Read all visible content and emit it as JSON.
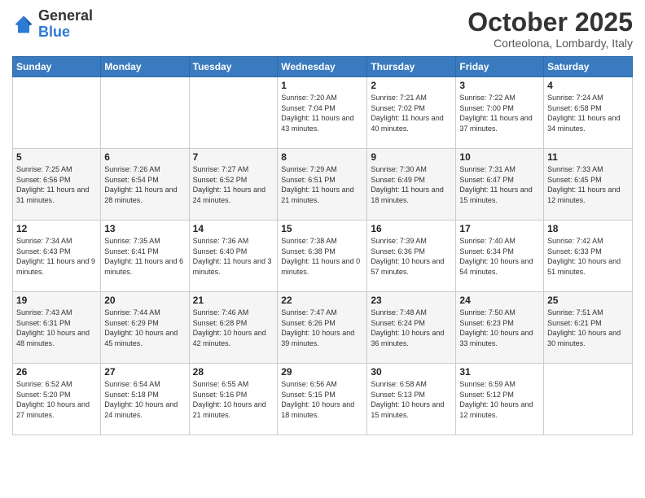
{
  "header": {
    "logo_general": "General",
    "logo_blue": "Blue",
    "month_title": "October 2025",
    "location": "Corteolona, Lombardy, Italy"
  },
  "days_of_week": [
    "Sunday",
    "Monday",
    "Tuesday",
    "Wednesday",
    "Thursday",
    "Friday",
    "Saturday"
  ],
  "weeks": [
    [
      {
        "day": "",
        "info": ""
      },
      {
        "day": "",
        "info": ""
      },
      {
        "day": "",
        "info": ""
      },
      {
        "day": "1",
        "info": "Sunrise: 7:20 AM\nSunset: 7:04 PM\nDaylight: 11 hours\nand 43 minutes."
      },
      {
        "day": "2",
        "info": "Sunrise: 7:21 AM\nSunset: 7:02 PM\nDaylight: 11 hours\nand 40 minutes."
      },
      {
        "day": "3",
        "info": "Sunrise: 7:22 AM\nSunset: 7:00 PM\nDaylight: 11 hours\nand 37 minutes."
      },
      {
        "day": "4",
        "info": "Sunrise: 7:24 AM\nSunset: 6:58 PM\nDaylight: 11 hours\nand 34 minutes."
      }
    ],
    [
      {
        "day": "5",
        "info": "Sunrise: 7:25 AM\nSunset: 6:56 PM\nDaylight: 11 hours\nand 31 minutes."
      },
      {
        "day": "6",
        "info": "Sunrise: 7:26 AM\nSunset: 6:54 PM\nDaylight: 11 hours\nand 28 minutes."
      },
      {
        "day": "7",
        "info": "Sunrise: 7:27 AM\nSunset: 6:52 PM\nDaylight: 11 hours\nand 24 minutes."
      },
      {
        "day": "8",
        "info": "Sunrise: 7:29 AM\nSunset: 6:51 PM\nDaylight: 11 hours\nand 21 minutes."
      },
      {
        "day": "9",
        "info": "Sunrise: 7:30 AM\nSunset: 6:49 PM\nDaylight: 11 hours\nand 18 minutes."
      },
      {
        "day": "10",
        "info": "Sunrise: 7:31 AM\nSunset: 6:47 PM\nDaylight: 11 hours\nand 15 minutes."
      },
      {
        "day": "11",
        "info": "Sunrise: 7:33 AM\nSunset: 6:45 PM\nDaylight: 11 hours\nand 12 minutes."
      }
    ],
    [
      {
        "day": "12",
        "info": "Sunrise: 7:34 AM\nSunset: 6:43 PM\nDaylight: 11 hours\nand 9 minutes."
      },
      {
        "day": "13",
        "info": "Sunrise: 7:35 AM\nSunset: 6:41 PM\nDaylight: 11 hours\nand 6 minutes."
      },
      {
        "day": "14",
        "info": "Sunrise: 7:36 AM\nSunset: 6:40 PM\nDaylight: 11 hours\nand 3 minutes."
      },
      {
        "day": "15",
        "info": "Sunrise: 7:38 AM\nSunset: 6:38 PM\nDaylight: 11 hours\nand 0 minutes."
      },
      {
        "day": "16",
        "info": "Sunrise: 7:39 AM\nSunset: 6:36 PM\nDaylight: 10 hours\nand 57 minutes."
      },
      {
        "day": "17",
        "info": "Sunrise: 7:40 AM\nSunset: 6:34 PM\nDaylight: 10 hours\nand 54 minutes."
      },
      {
        "day": "18",
        "info": "Sunrise: 7:42 AM\nSunset: 6:33 PM\nDaylight: 10 hours\nand 51 minutes."
      }
    ],
    [
      {
        "day": "19",
        "info": "Sunrise: 7:43 AM\nSunset: 6:31 PM\nDaylight: 10 hours\nand 48 minutes."
      },
      {
        "day": "20",
        "info": "Sunrise: 7:44 AM\nSunset: 6:29 PM\nDaylight: 10 hours\nand 45 minutes."
      },
      {
        "day": "21",
        "info": "Sunrise: 7:46 AM\nSunset: 6:28 PM\nDaylight: 10 hours\nand 42 minutes."
      },
      {
        "day": "22",
        "info": "Sunrise: 7:47 AM\nSunset: 6:26 PM\nDaylight: 10 hours\nand 39 minutes."
      },
      {
        "day": "23",
        "info": "Sunrise: 7:48 AM\nSunset: 6:24 PM\nDaylight: 10 hours\nand 36 minutes."
      },
      {
        "day": "24",
        "info": "Sunrise: 7:50 AM\nSunset: 6:23 PM\nDaylight: 10 hours\nand 33 minutes."
      },
      {
        "day": "25",
        "info": "Sunrise: 7:51 AM\nSunset: 6:21 PM\nDaylight: 10 hours\nand 30 minutes."
      }
    ],
    [
      {
        "day": "26",
        "info": "Sunrise: 6:52 AM\nSunset: 5:20 PM\nDaylight: 10 hours\nand 27 minutes."
      },
      {
        "day": "27",
        "info": "Sunrise: 6:54 AM\nSunset: 5:18 PM\nDaylight: 10 hours\nand 24 minutes."
      },
      {
        "day": "28",
        "info": "Sunrise: 6:55 AM\nSunset: 5:16 PM\nDaylight: 10 hours\nand 21 minutes."
      },
      {
        "day": "29",
        "info": "Sunrise: 6:56 AM\nSunset: 5:15 PM\nDaylight: 10 hours\nand 18 minutes."
      },
      {
        "day": "30",
        "info": "Sunrise: 6:58 AM\nSunset: 5:13 PM\nDaylight: 10 hours\nand 15 minutes."
      },
      {
        "day": "31",
        "info": "Sunrise: 6:59 AM\nSunset: 5:12 PM\nDaylight: 10 hours\nand 12 minutes."
      },
      {
        "day": "",
        "info": ""
      }
    ]
  ]
}
